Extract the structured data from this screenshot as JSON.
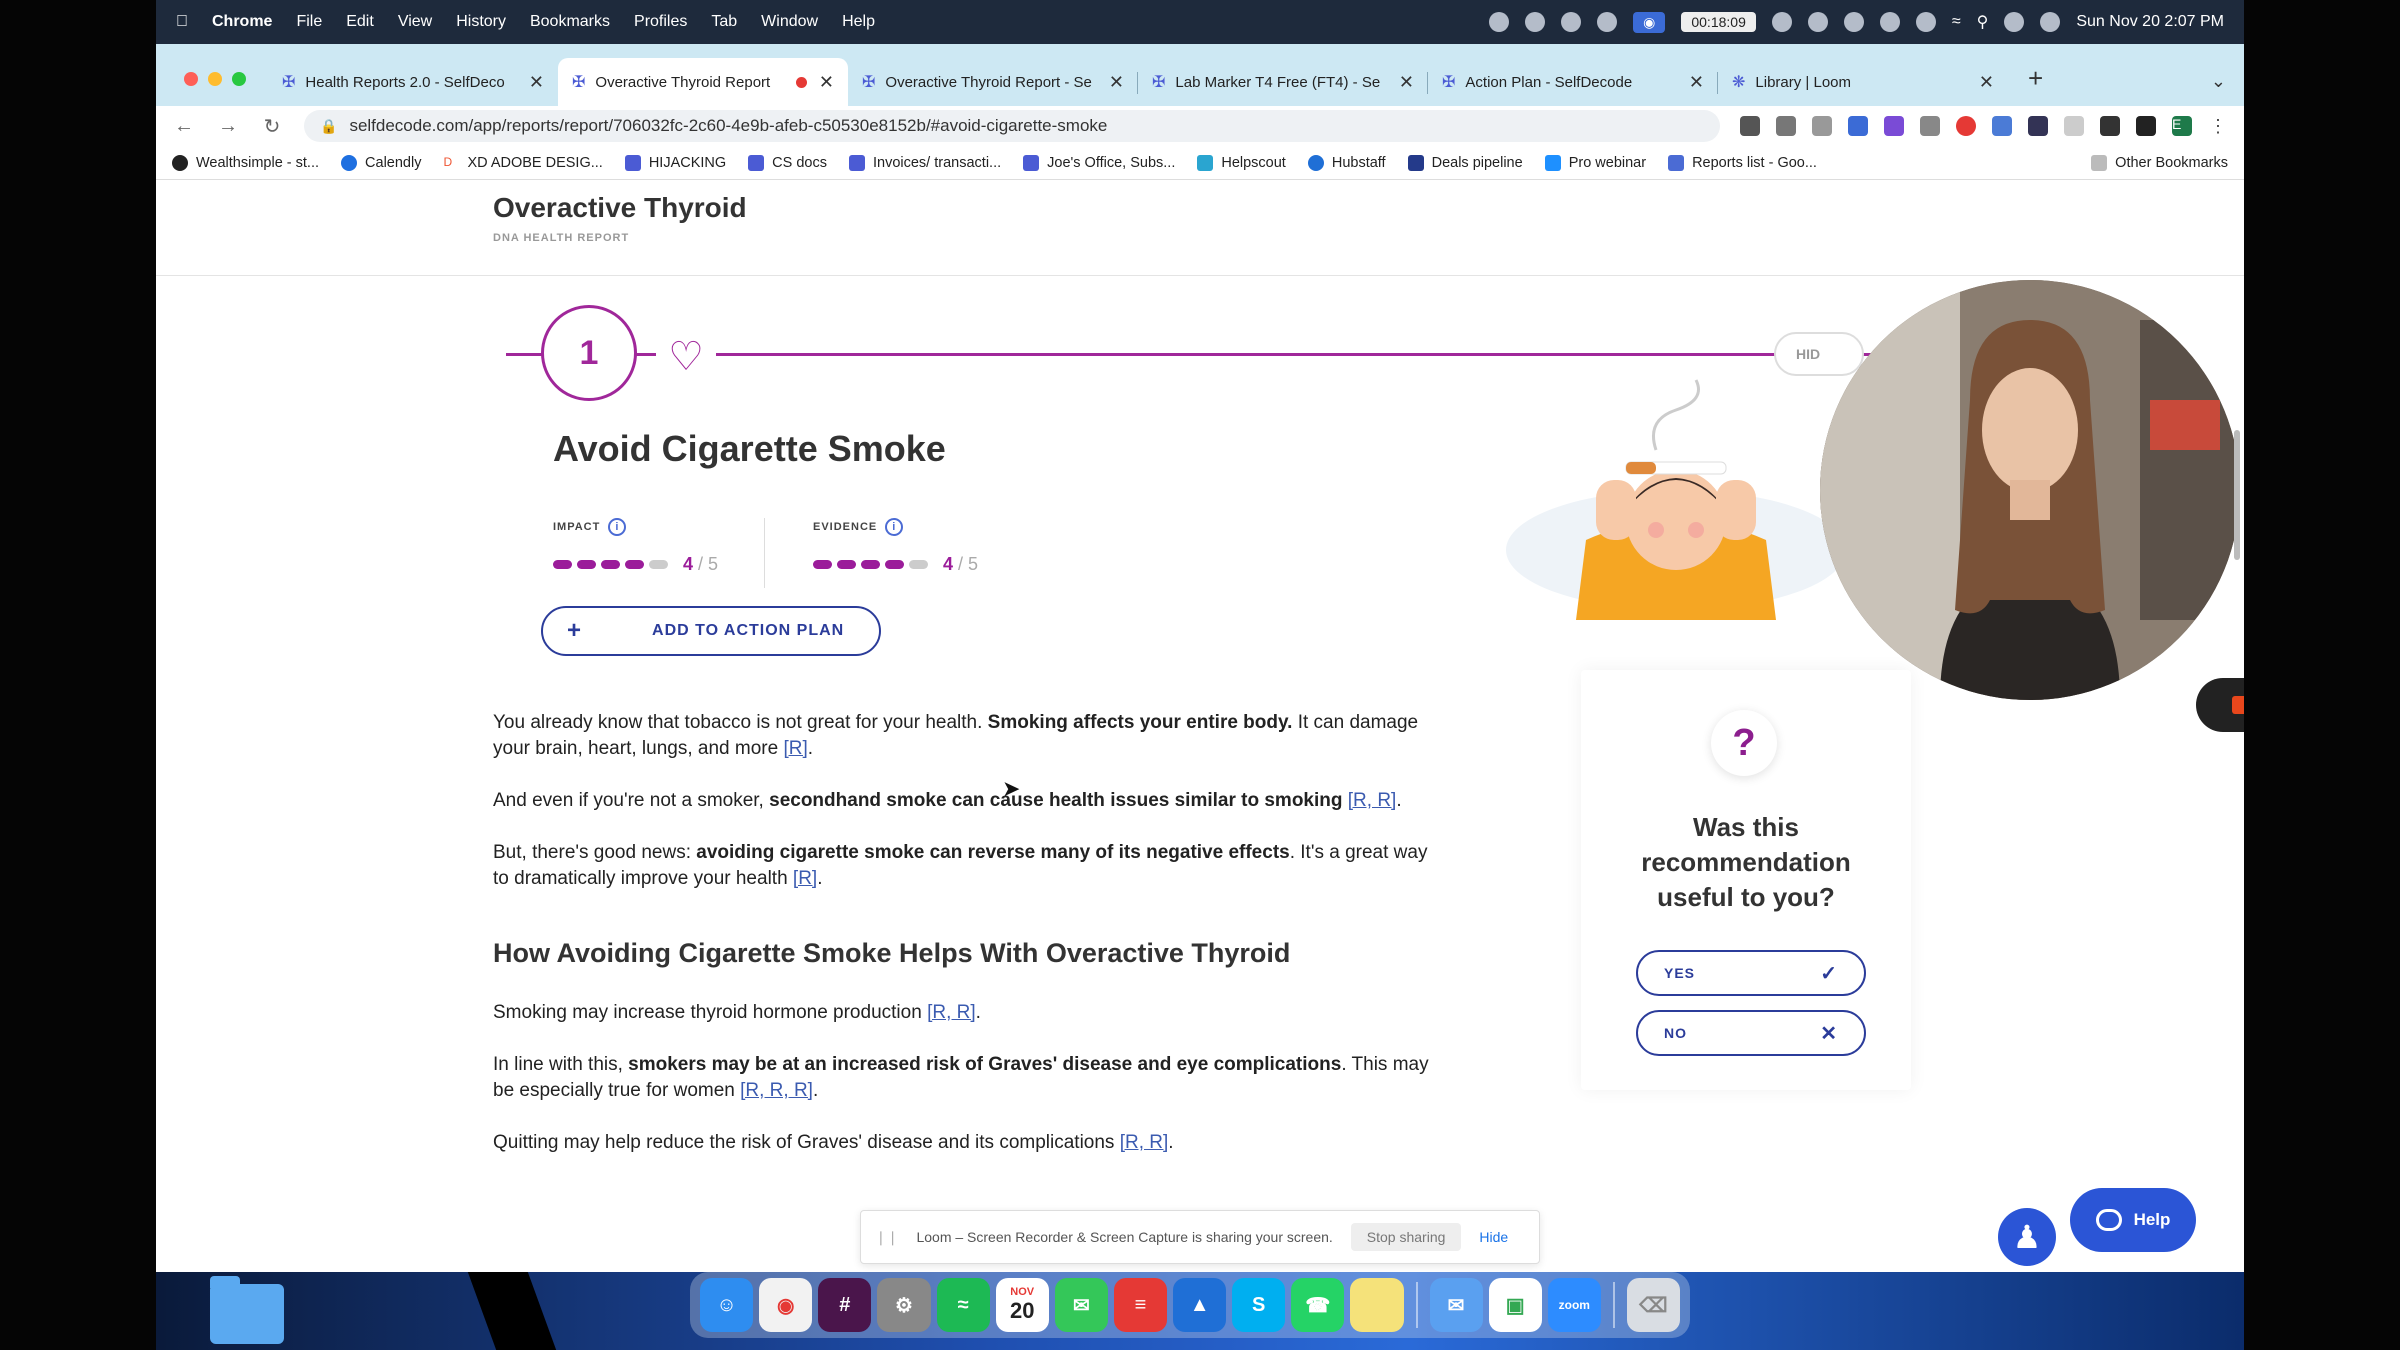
{
  "menubar": {
    "app": "Chrome",
    "items": [
      "File",
      "Edit",
      "View",
      "History",
      "Bookmarks",
      "Profiles",
      "Tab",
      "Window",
      "Help"
    ],
    "timer": "00:18:09",
    "datetime": "Sun Nov 20  2:07 PM"
  },
  "tabs": [
    {
      "title": "Health Reports 2.0 - SelfDeco"
    },
    {
      "title": "Overactive Thyroid Report"
    },
    {
      "title": "Overactive Thyroid Report - Se"
    },
    {
      "title": "Lab Marker T4 Free (FT4) - Se"
    },
    {
      "title": "Action Plan - SelfDecode"
    },
    {
      "title": "Library | Loom"
    }
  ],
  "omnibox": {
    "url": "selfdecode.com/app/reports/report/706032fc-2c60-4e9b-afeb-c50530e8152b/#avoid-cigarette-smoke"
  },
  "bookmarks": [
    "Wealthsimple - st...",
    "Calendly",
    "XD ADOBE DESIG...",
    "HIJACKING",
    "CS docs",
    "Invoices/ transacti...",
    "Joe's Office, Subs...",
    "Helpscout",
    "Hubstaff",
    "Deals pipeline",
    "Pro webinar",
    "Reports list - Goo..."
  ],
  "bookmarks_other": "Other Bookmarks",
  "page": {
    "title": "Overactive Thyroid",
    "subtitle": "DNA HEALTH REPORT",
    "step_number": "1",
    "hide_label": "HID",
    "rec_title": "Avoid Cigarette Smoke",
    "impact": {
      "label": "IMPACT",
      "score": "4",
      "max": "/ 5",
      "value": 4
    },
    "evidence": {
      "label": "EVIDENCE",
      "score": "4",
      "max": "/ 5",
      "value": 4
    },
    "add_label": "ADD TO ACTION PLAN"
  },
  "article": {
    "p1_a": "You already know that tobacco is not great for your health. ",
    "p1_b": "Smoking affects your entire body.",
    "p1_c": " It can damage your brain, heart, lungs, and more ",
    "p1_ref": "[R]",
    "p2_a": "And even if you're not a smoker, ",
    "p2_b": "secondhand smoke can cause health issues similar to smoking",
    "p2_ref": "[R, R]",
    "p3_a": "But, there's good news: ",
    "p3_b": "avoiding cigarette smoke can reverse many of its negative effects",
    "p3_c": ". It's a great way to dramatically improve your health ",
    "p3_ref": "[R]",
    "h2": "How Avoiding Cigarette Smoke Helps With Overactive Thyroid",
    "p4_a": "Smoking may increase thyroid hormone production ",
    "p4_ref": "[R, R]",
    "p5_a": "In line with this, ",
    "p5_b": "smokers may be at an increased risk of Graves' disease and eye complications",
    "p5_c": ". This may be especially true for women ",
    "p5_ref": "[R, R, R]",
    "p6_a": "Quitting may help reduce the risk of Graves' disease and its complications ",
    "p6_ref": "[R, R]"
  },
  "feedback": {
    "q": "?",
    "text": "Was this recommendation useful to you?",
    "yes": "YES",
    "no": "NO"
  },
  "sharebar": {
    "text": "Loom – Screen Recorder & Screen Capture is sharing your screen.",
    "stop": "Stop sharing",
    "hide": "Hide"
  },
  "help_label": "Help",
  "dock": {
    "calendar_month": "NOV",
    "calendar_day": "20"
  },
  "colors": {
    "accent": "#a0279a",
    "primary": "#2b3c9a",
    "help": "#2b55d6",
    "tabbar": "#cde8f3"
  }
}
